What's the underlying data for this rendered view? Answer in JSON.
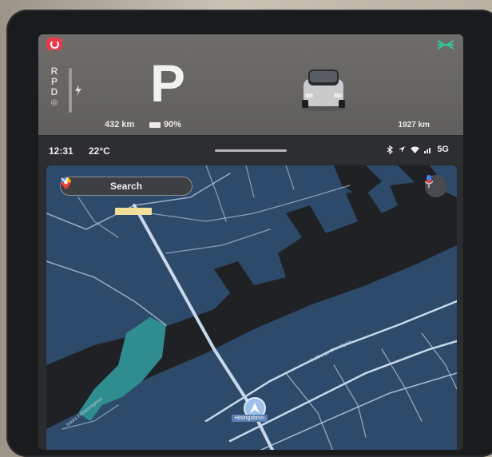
{
  "driver_panel": {
    "gears": [
      "R",
      "P",
      "D"
    ],
    "current_gear": "P",
    "range": "432 km",
    "battery": "90%",
    "odometer": "1927 km"
  },
  "status_bar": {
    "time": "12:31",
    "temperature": "22°C",
    "network": "5G",
    "icons": [
      "bluetooth-icon",
      "location-arrow-icon",
      "wifi-icon",
      "signal-icon"
    ]
  },
  "map": {
    "search_label": "Search",
    "place_label": "Hisingsbron",
    "road_labels": {
      "r1": "Gullbergs Strandgata",
      "r2": "Södra Frihamnspiren"
    }
  },
  "colors": {
    "alert": "#e53d4e",
    "lights": "#34c79a",
    "map_land": "#2e4a6a",
    "map_water": "#1f2124",
    "map_park": "#2f8c8f",
    "road": "#c8d9ec"
  }
}
